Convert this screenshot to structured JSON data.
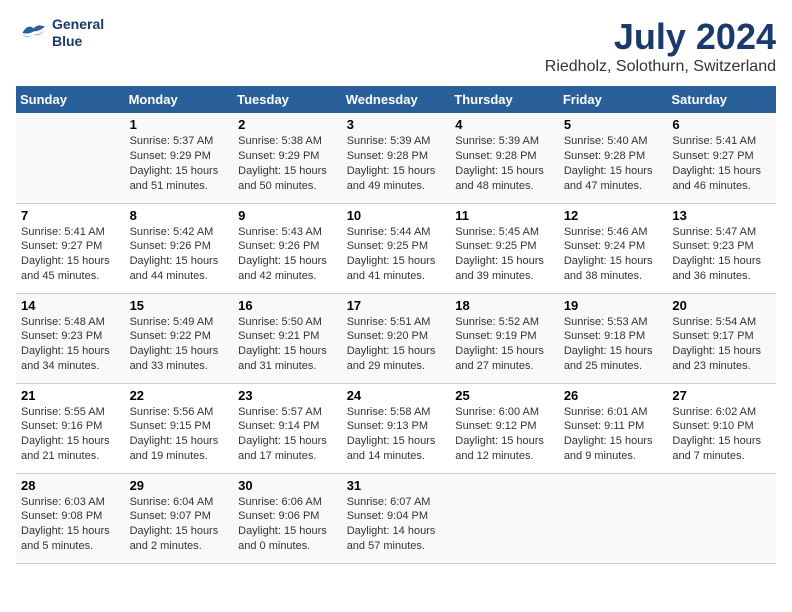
{
  "logo": {
    "line1": "General",
    "line2": "Blue"
  },
  "title": "July 2024",
  "subtitle": "Riedholz, Solothurn, Switzerland",
  "days_of_week": [
    "Sunday",
    "Monday",
    "Tuesday",
    "Wednesday",
    "Thursday",
    "Friday",
    "Saturday"
  ],
  "weeks": [
    [
      {
        "day": "",
        "info": ""
      },
      {
        "day": "1",
        "info": "Sunrise: 5:37 AM\nSunset: 9:29 PM\nDaylight: 15 hours\nand 51 minutes."
      },
      {
        "day": "2",
        "info": "Sunrise: 5:38 AM\nSunset: 9:29 PM\nDaylight: 15 hours\nand 50 minutes."
      },
      {
        "day": "3",
        "info": "Sunrise: 5:39 AM\nSunset: 9:28 PM\nDaylight: 15 hours\nand 49 minutes."
      },
      {
        "day": "4",
        "info": "Sunrise: 5:39 AM\nSunset: 9:28 PM\nDaylight: 15 hours\nand 48 minutes."
      },
      {
        "day": "5",
        "info": "Sunrise: 5:40 AM\nSunset: 9:28 PM\nDaylight: 15 hours\nand 47 minutes."
      },
      {
        "day": "6",
        "info": "Sunrise: 5:41 AM\nSunset: 9:27 PM\nDaylight: 15 hours\nand 46 minutes."
      }
    ],
    [
      {
        "day": "7",
        "info": "Sunrise: 5:41 AM\nSunset: 9:27 PM\nDaylight: 15 hours\nand 45 minutes."
      },
      {
        "day": "8",
        "info": "Sunrise: 5:42 AM\nSunset: 9:26 PM\nDaylight: 15 hours\nand 44 minutes."
      },
      {
        "day": "9",
        "info": "Sunrise: 5:43 AM\nSunset: 9:26 PM\nDaylight: 15 hours\nand 42 minutes."
      },
      {
        "day": "10",
        "info": "Sunrise: 5:44 AM\nSunset: 9:25 PM\nDaylight: 15 hours\nand 41 minutes."
      },
      {
        "day": "11",
        "info": "Sunrise: 5:45 AM\nSunset: 9:25 PM\nDaylight: 15 hours\nand 39 minutes."
      },
      {
        "day": "12",
        "info": "Sunrise: 5:46 AM\nSunset: 9:24 PM\nDaylight: 15 hours\nand 38 minutes."
      },
      {
        "day": "13",
        "info": "Sunrise: 5:47 AM\nSunset: 9:23 PM\nDaylight: 15 hours\nand 36 minutes."
      }
    ],
    [
      {
        "day": "14",
        "info": "Sunrise: 5:48 AM\nSunset: 9:23 PM\nDaylight: 15 hours\nand 34 minutes."
      },
      {
        "day": "15",
        "info": "Sunrise: 5:49 AM\nSunset: 9:22 PM\nDaylight: 15 hours\nand 33 minutes."
      },
      {
        "day": "16",
        "info": "Sunrise: 5:50 AM\nSunset: 9:21 PM\nDaylight: 15 hours\nand 31 minutes."
      },
      {
        "day": "17",
        "info": "Sunrise: 5:51 AM\nSunset: 9:20 PM\nDaylight: 15 hours\nand 29 minutes."
      },
      {
        "day": "18",
        "info": "Sunrise: 5:52 AM\nSunset: 9:19 PM\nDaylight: 15 hours\nand 27 minutes."
      },
      {
        "day": "19",
        "info": "Sunrise: 5:53 AM\nSunset: 9:18 PM\nDaylight: 15 hours\nand 25 minutes."
      },
      {
        "day": "20",
        "info": "Sunrise: 5:54 AM\nSunset: 9:17 PM\nDaylight: 15 hours\nand 23 minutes."
      }
    ],
    [
      {
        "day": "21",
        "info": "Sunrise: 5:55 AM\nSunset: 9:16 PM\nDaylight: 15 hours\nand 21 minutes."
      },
      {
        "day": "22",
        "info": "Sunrise: 5:56 AM\nSunset: 9:15 PM\nDaylight: 15 hours\nand 19 minutes."
      },
      {
        "day": "23",
        "info": "Sunrise: 5:57 AM\nSunset: 9:14 PM\nDaylight: 15 hours\nand 17 minutes."
      },
      {
        "day": "24",
        "info": "Sunrise: 5:58 AM\nSunset: 9:13 PM\nDaylight: 15 hours\nand 14 minutes."
      },
      {
        "day": "25",
        "info": "Sunrise: 6:00 AM\nSunset: 9:12 PM\nDaylight: 15 hours\nand 12 minutes."
      },
      {
        "day": "26",
        "info": "Sunrise: 6:01 AM\nSunset: 9:11 PM\nDaylight: 15 hours\nand 9 minutes."
      },
      {
        "day": "27",
        "info": "Sunrise: 6:02 AM\nSunset: 9:10 PM\nDaylight: 15 hours\nand 7 minutes."
      }
    ],
    [
      {
        "day": "28",
        "info": "Sunrise: 6:03 AM\nSunset: 9:08 PM\nDaylight: 15 hours\nand 5 minutes."
      },
      {
        "day": "29",
        "info": "Sunrise: 6:04 AM\nSunset: 9:07 PM\nDaylight: 15 hours\nand 2 minutes."
      },
      {
        "day": "30",
        "info": "Sunrise: 6:06 AM\nSunset: 9:06 PM\nDaylight: 15 hours\nand 0 minutes."
      },
      {
        "day": "31",
        "info": "Sunrise: 6:07 AM\nSunset: 9:04 PM\nDaylight: 14 hours\nand 57 minutes."
      },
      {
        "day": "",
        "info": ""
      },
      {
        "day": "",
        "info": ""
      },
      {
        "day": "",
        "info": ""
      }
    ]
  ]
}
